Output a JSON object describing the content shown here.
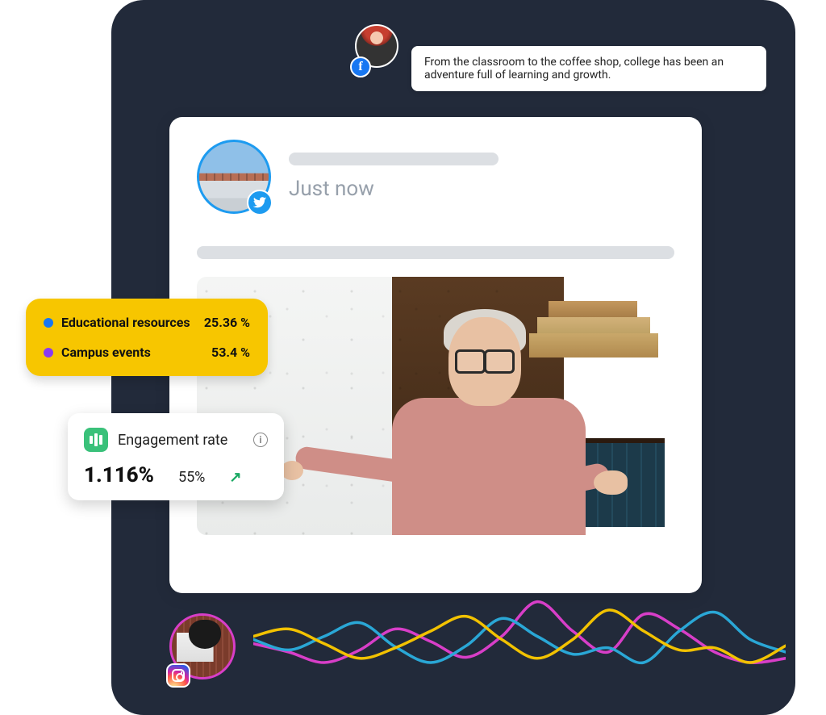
{
  "speech": {
    "text": "From the classroom to the coffee shop, college has been an adventure full of learning and growth."
  },
  "post": {
    "timestamp": "Just now"
  },
  "stats": {
    "items": [
      {
        "label": "Educational resources",
        "value": "25.36 %",
        "color": "#1877F2"
      },
      {
        "label": "Campus events",
        "value": "53.4 %",
        "color": "#8a3bf2"
      }
    ]
  },
  "engagement": {
    "title": "Engagement rate",
    "value": "1.116%",
    "delta": "55%"
  },
  "chart_data": {
    "type": "line",
    "title": "",
    "xlabel": "",
    "ylabel": "",
    "x": [
      0,
      1,
      2,
      3,
      4,
      5,
      6,
      7,
      8,
      9,
      10,
      11,
      12,
      13,
      14,
      15
    ],
    "ylim": [
      0,
      100
    ],
    "series": [
      {
        "name": "magenta",
        "color": "#d83ec8",
        "values": [
          48,
          40,
          30,
          42,
          62,
          50,
          35,
          55,
          88,
          60,
          40,
          76,
          62,
          40,
          30,
          34
        ]
      },
      {
        "name": "cyan",
        "color": "#2aa7d6",
        "values": [
          52,
          42,
          55,
          68,
          45,
          30,
          46,
          72,
          55,
          38,
          44,
          30,
          60,
          78,
          52,
          40
        ]
      },
      {
        "name": "yellow",
        "color": "#f2c200",
        "values": [
          55,
          62,
          48,
          34,
          44,
          60,
          74,
          52,
          34,
          52,
          80,
          60,
          42,
          44,
          30,
          46
        ]
      }
    ]
  }
}
